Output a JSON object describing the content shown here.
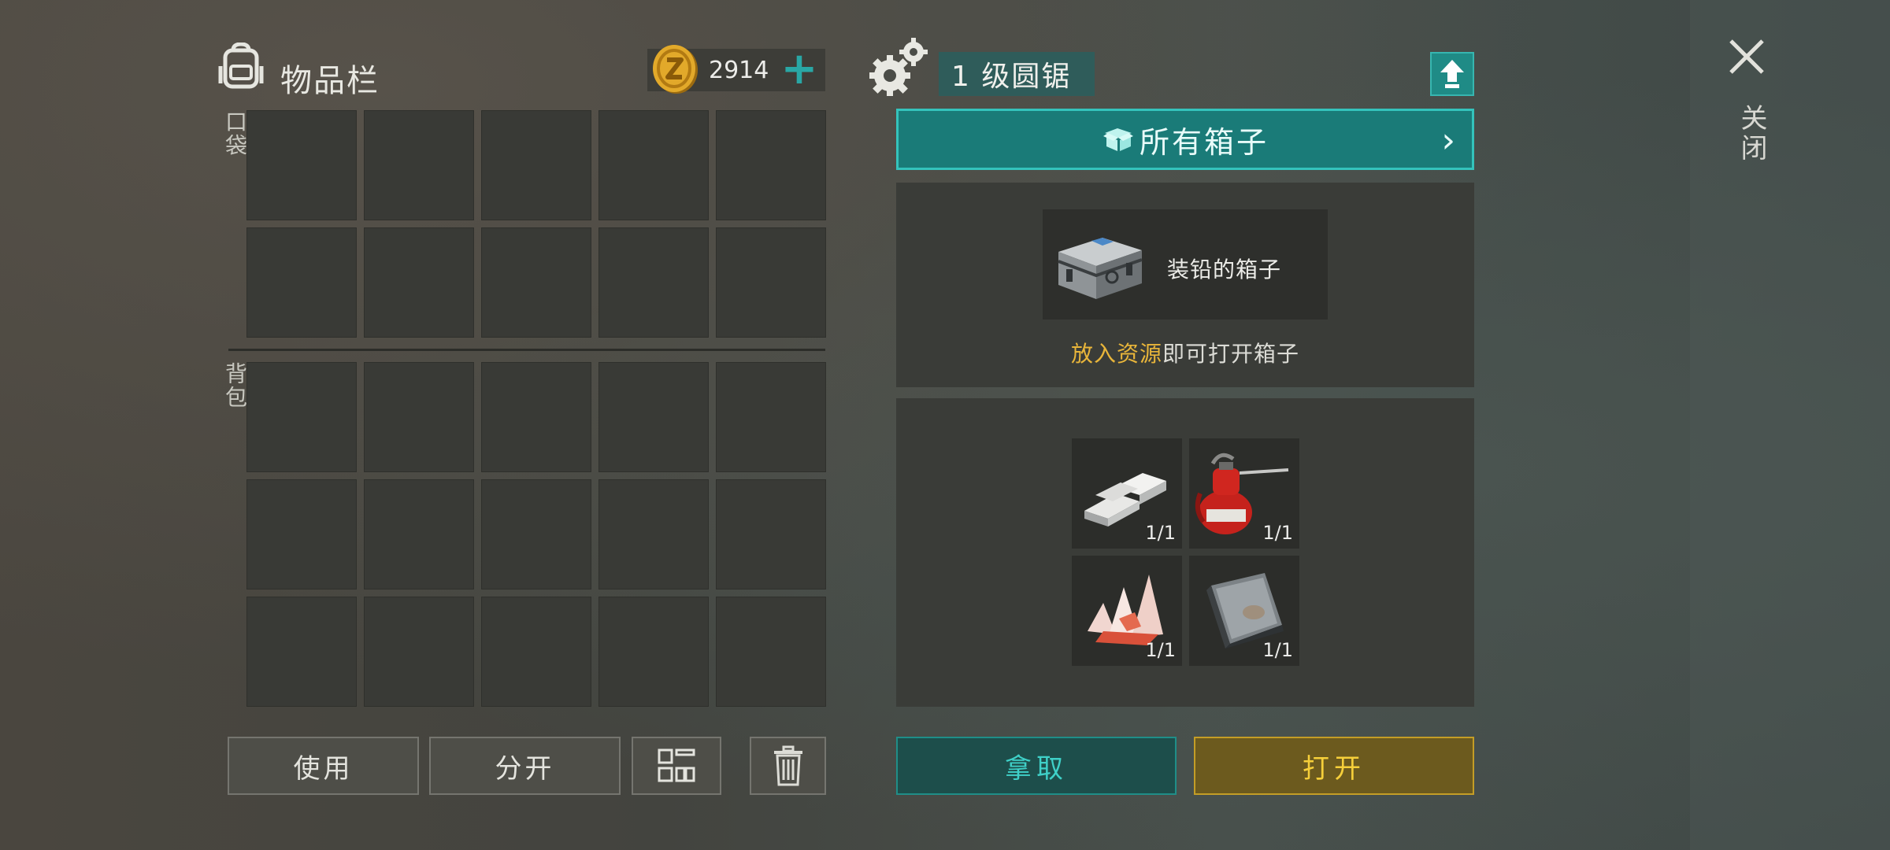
{
  "inventory": {
    "title": "物品栏",
    "coins": "2914",
    "add_symbol": "+",
    "pocket_label": "口袋",
    "bag_label": "背包",
    "pocket_slots": 10,
    "bag_slots": 15,
    "buttons": {
      "use": "使用",
      "split": "分开"
    }
  },
  "workbench": {
    "level_title": "1 级圆锯",
    "all_boxes_label": "所有箱子",
    "crate_name": "装铅的箱子",
    "hint_highlight": "放入资源",
    "hint_rest": "即可打开箱子",
    "resources": [
      {
        "icon": "lead-ingots-icon",
        "count": "1/1"
      },
      {
        "icon": "oil-can-icon",
        "count": "1/1"
      },
      {
        "icon": "quartz-crystal-icon",
        "count": "1/1"
      },
      {
        "icon": "iron-plate-icon",
        "count": "1/1"
      }
    ],
    "buttons": {
      "take": "拿取",
      "open": "打开"
    }
  },
  "close_label": "关闭",
  "colors": {
    "teal_accent": "#1a7b78",
    "teal_border": "#34c3bc",
    "gold_button": "#c49d26",
    "hint_highlight": "#e8b53a"
  }
}
